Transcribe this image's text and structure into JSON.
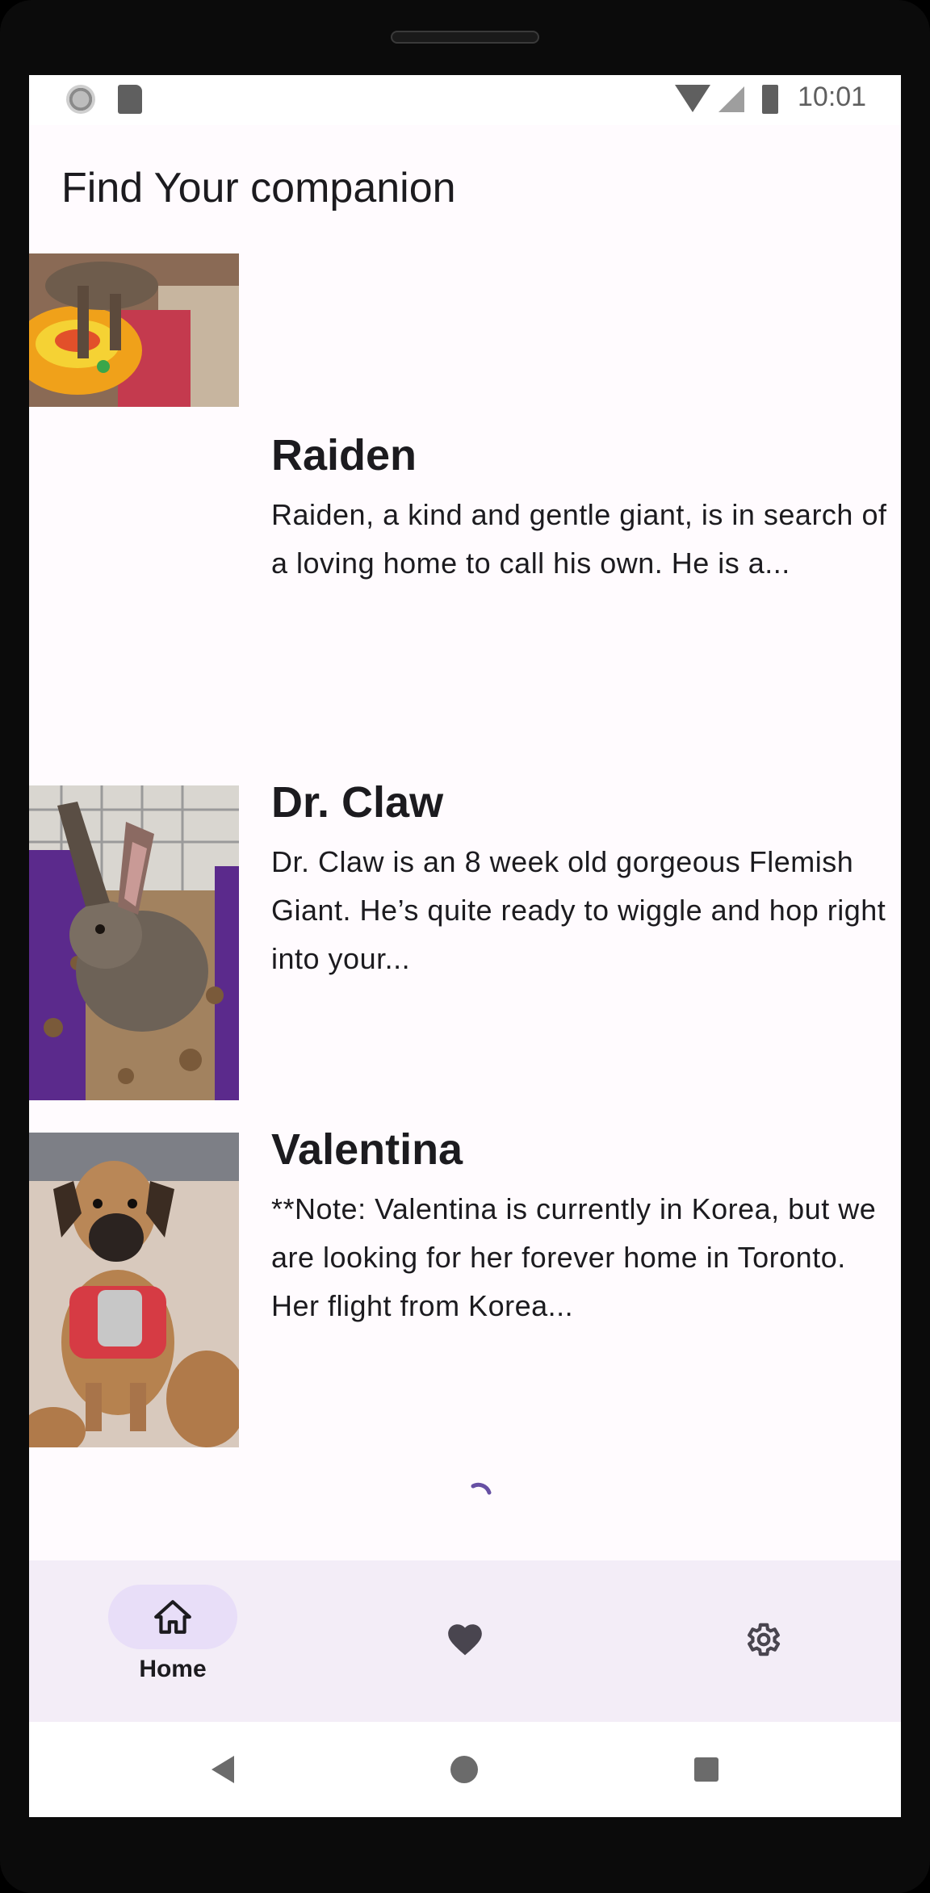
{
  "status_bar": {
    "time": "10:01"
  },
  "app_bar": {
    "title": "Find Your companion"
  },
  "pets": [
    {
      "name": "Raiden",
      "description": "Raiden, a kind and gentle giant, is in search of a loving home to call his own. He is a...",
      "photo": "cat-photo"
    },
    {
      "name": "Dr. Claw",
      "description": "Dr. Claw is an 8 week old gorgeous Flemish Giant. He’s quite ready to wiggle and hop right into your...",
      "photo": "rabbit-photo"
    },
    {
      "name": "Valentina",
      "description": "**Note: Valentina is currently in Korea, but we are looking for her forever home in Toronto. Her flight from Korea...",
      "photo": "dog-photo"
    }
  ],
  "bottom_nav": {
    "items": [
      {
        "label": "Home",
        "icon": "home-icon",
        "selected": true
      },
      {
        "label": "",
        "icon": "heart-icon",
        "selected": false
      },
      {
        "label": "",
        "icon": "gear-icon",
        "selected": false
      }
    ]
  },
  "colors": {
    "background": "#fffbfe",
    "nav_background": "#f3edf7",
    "nav_indicator": "#e8def8",
    "spinner": "#6750a4",
    "text": "#1c1b1f"
  }
}
